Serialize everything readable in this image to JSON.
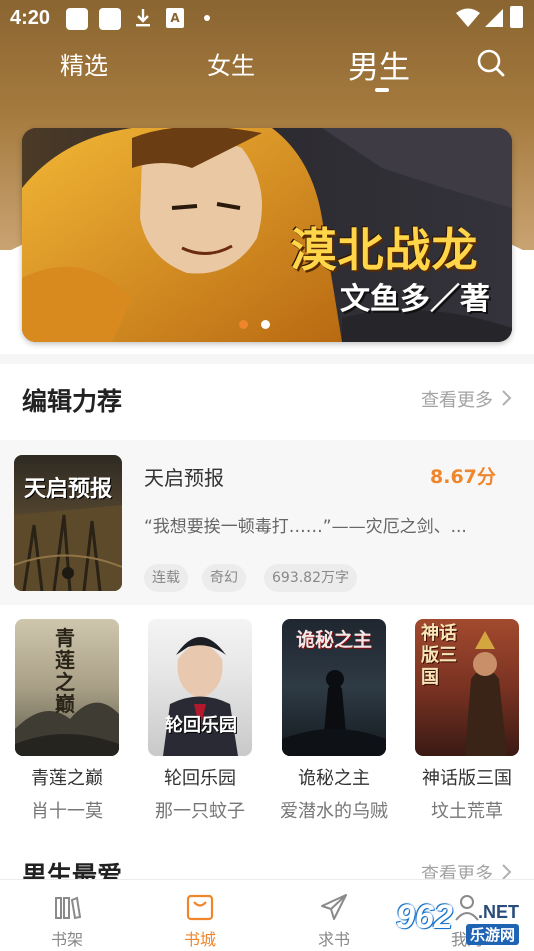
{
  "status_bar": {
    "time": "4:20",
    "notification_letter": "A"
  },
  "tabs": [
    {
      "label": "精选",
      "active": false
    },
    {
      "label": "女生",
      "active": false
    },
    {
      "label": "男生",
      "active": true
    }
  ],
  "banner": {
    "title": "漠北战龙",
    "author": "文鱼多／著",
    "slide_count": 2,
    "active_slide": 1
  },
  "editor_picks": {
    "title": "编辑力荐",
    "more_label": "查看更多",
    "featured": {
      "cover_title": "天启预报",
      "name": "天启预报",
      "score": "8.67分",
      "description": "“我想要挨一顿毒打……”——灾厄之剑、...",
      "tags": [
        "连载",
        "奇幻",
        "693.82万字"
      ]
    },
    "books": [
      {
        "title": "青莲之巅",
        "author": "肖十一莫",
        "cover_text": "青莲之巅"
      },
      {
        "title": "轮回乐园",
        "author": "那一只蚊子",
        "cover_text": "轮回乐园"
      },
      {
        "title": "诡秘之主",
        "author": "爱潜水的乌贼",
        "cover_text": "诡秘之主"
      },
      {
        "title": "神话版三国",
        "author": "坟土荒草",
        "cover_text": "神话版三国"
      }
    ]
  },
  "male_favorites": {
    "title": "男生最爱",
    "more_label": "查看更多"
  },
  "bottom_nav": [
    {
      "label": "书架",
      "icon": "bookshelf-icon",
      "active": false
    },
    {
      "label": "书城",
      "icon": "bookstore-bag-icon",
      "active": true
    },
    {
      "label": "求书",
      "icon": "paper-plane-icon",
      "active": false
    },
    {
      "label": "我的",
      "icon": "profile-icon",
      "active": false
    }
  ],
  "watermark": {
    "number": "962",
    "suffix": ".NET",
    "site": "乐游网"
  },
  "colors": {
    "accent": "#f0862c",
    "header_top": "#8a6531",
    "header_bottom": "#c9a372"
  }
}
